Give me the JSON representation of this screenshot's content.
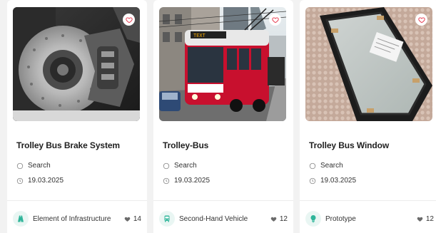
{
  "cards": [
    {
      "title": "Trolley Bus Brake System",
      "location": "Search",
      "date": "19.03.2025",
      "category": "Element of Infrastructure",
      "category_icon": "road-icon",
      "likes": "14"
    },
    {
      "title": "Trolley-Bus",
      "location": "Search",
      "date": "19.03.2025",
      "category": "Second-Hand Vehicle",
      "category_icon": "bus-icon",
      "likes": "12"
    },
    {
      "title": "Trolley Bus Window",
      "location": "Search",
      "date": "19.03.2025",
      "category": "Prototype",
      "category_icon": "lightbulb-icon",
      "likes": "12"
    }
  ],
  "colors": {
    "accent": "#e8475a",
    "category_icon": "#2fb59a",
    "category_bg": "#e9f6f3"
  }
}
